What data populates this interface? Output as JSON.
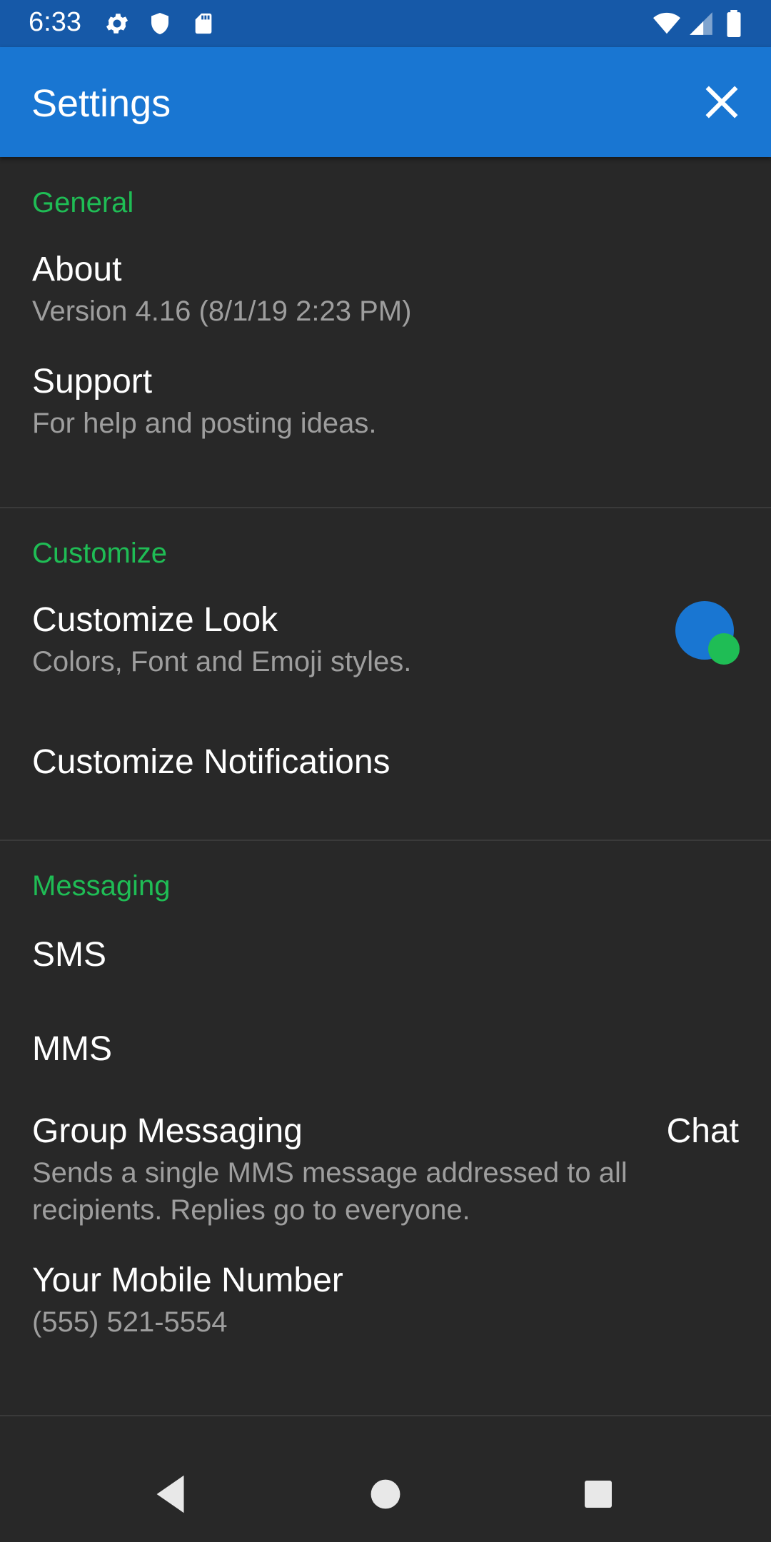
{
  "status_bar": {
    "time": "6:33",
    "left_icons": [
      "gear-icon",
      "shield-icon",
      "sd-card-icon"
    ],
    "right_icons": [
      "wifi-icon",
      "cell-signal-icon",
      "battery-icon"
    ]
  },
  "app_bar": {
    "title": "Settings",
    "close_icon": "close-icon",
    "color": "#1976d2"
  },
  "sections": {
    "general": {
      "header": "General",
      "about": {
        "title": "About",
        "subtitle": "Version 4.16 (8/1/19 2:23 PM)"
      },
      "support": {
        "title": "Support",
        "subtitle": "For help and posting ideas."
      }
    },
    "customize": {
      "header": "Customize",
      "look": {
        "title": "Customize Look",
        "subtitle": "Colors, Font and Emoji styles.",
        "icon": "color-dots-icon"
      },
      "notifications": {
        "title": "Customize Notifications"
      }
    },
    "messaging": {
      "header": "Messaging",
      "sms": {
        "title": "SMS"
      },
      "mms": {
        "title": "MMS"
      },
      "group": {
        "title": "Group Messaging",
        "value": "Chat",
        "subtitle_line1": "Sends a single MMS message addressed to all",
        "subtitle_line2": "recipients. Replies go to everyone."
      },
      "mobile": {
        "title": "Your Mobile Number",
        "subtitle": "(555) 521-5554"
      }
    }
  },
  "nav_bar": {
    "back_icon": "back-triangle-icon",
    "home_icon": "home-circle-icon",
    "recents_icon": "recents-square-icon"
  },
  "colors": {
    "accent": "#1fbd55",
    "primary": "#1976d2",
    "status_bar": "#1659a8",
    "background": "#282828"
  }
}
